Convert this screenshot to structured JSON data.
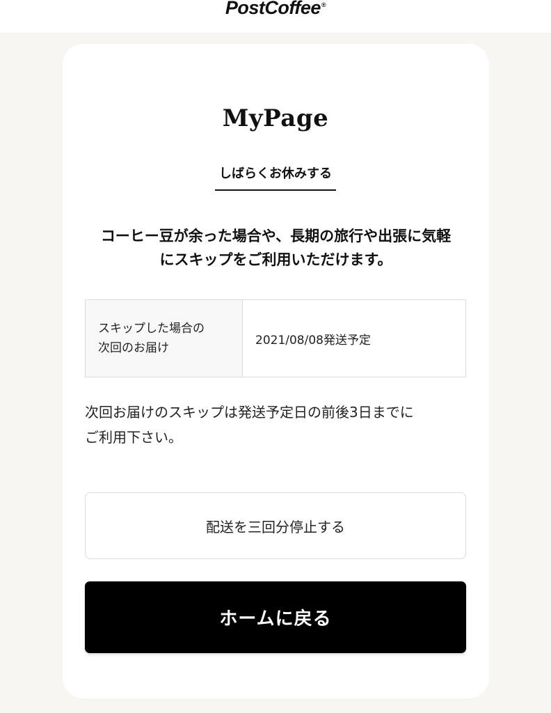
{
  "header": {
    "logo_text": "PostCoffee",
    "logo_mark": "®"
  },
  "page": {
    "title": "MyPage",
    "tab_label": "しばらくお休みする",
    "lead_line1": "コーヒー豆が余った場合や、長期の旅行や出張に気軽",
    "lead_line2": "にスキップをご利用いただけます。"
  },
  "info_table": {
    "label_line1": "スキップした場合の",
    "label_line2": "次回のお届け",
    "value": "2021/08/08発送予定"
  },
  "note": {
    "line1": "次回お届けのスキップは発送予定日の前後3日までに",
    "line2": "ご利用下さい。"
  },
  "buttons": {
    "pause_three_label": "配送を三回分停止する",
    "home_label": "ホームに戻る"
  },
  "colors": {
    "background": "#f7f6f2",
    "card": "#ffffff",
    "primary_button": "#000000"
  }
}
